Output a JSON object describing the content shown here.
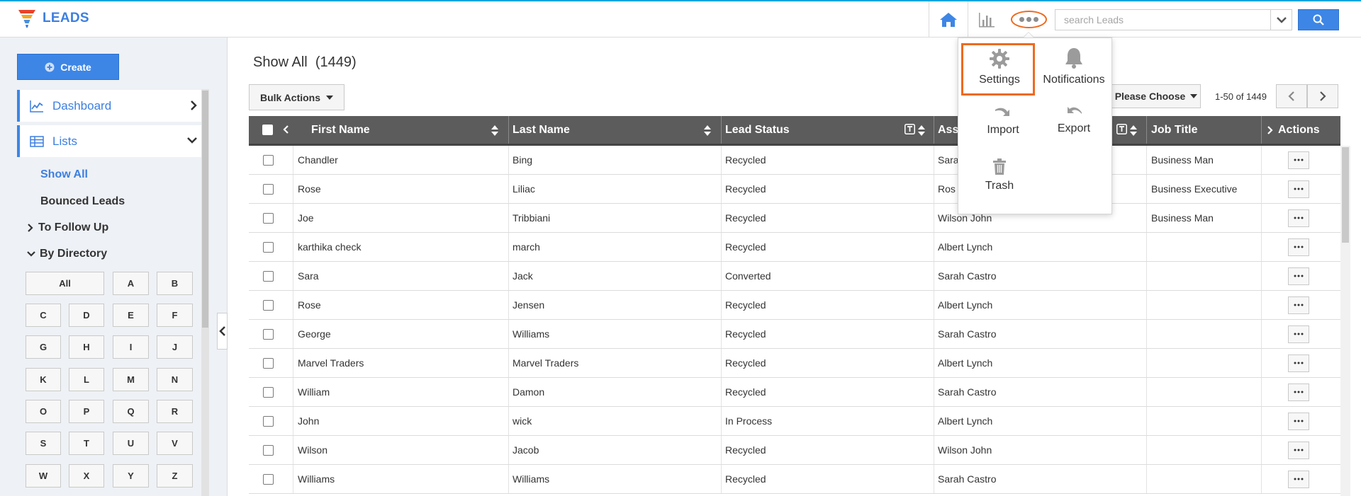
{
  "app": {
    "title": "LEADS",
    "brand_color": "#3d7fe0"
  },
  "header": {
    "search_placeholder": "search Leads",
    "icons": [
      "home-icon",
      "bar-chart-icon",
      "more-icon",
      "chevron-down-icon",
      "search-icon"
    ]
  },
  "more_menu": {
    "items": [
      {
        "label": "Settings",
        "icon": "gear-icon",
        "highlighted": true
      },
      {
        "label": "Notifications",
        "icon": "bell-icon"
      },
      {
        "label": "Import",
        "icon": "import-icon"
      },
      {
        "label": "Export",
        "icon": "export-icon"
      },
      {
        "label": "Trash",
        "icon": "trash-icon"
      }
    ]
  },
  "sidebar": {
    "create_label": "Create",
    "dashboard_label": "Dashboard",
    "lists_label": "Lists",
    "show_all_label": "Show All",
    "bounced_label": "Bounced Leads",
    "follow_up_label": "To Follow Up",
    "by_directory_label": "By Directory",
    "letters": [
      "All",
      "A",
      "B",
      "C",
      "D",
      "E",
      "F",
      "G",
      "H",
      "I",
      "J",
      "K",
      "L",
      "M",
      "N",
      "O",
      "P",
      "Q",
      "R",
      "S",
      "T",
      "U",
      "V",
      "W",
      "X",
      "Y",
      "Z"
    ]
  },
  "main": {
    "title": "Show All",
    "count": "(1449)",
    "bulk_actions_label": "Bulk Actions",
    "please_choose_label": "Please Choose",
    "pagination": "1-50 of 1449"
  },
  "table": {
    "columns": {
      "first_name": "First Name",
      "last_name": "Last Name",
      "lead_status": "Lead Status",
      "assigned_to": "Ass",
      "job_title": "Job Title",
      "actions": "Actions"
    },
    "rows": [
      {
        "first": "Chandler",
        "last": "Bing",
        "status": "Recycled",
        "assigned": "Sara",
        "job": "Business Man"
      },
      {
        "first": "Rose",
        "last": "Liliac",
        "status": "Recycled",
        "assigned": "Ros",
        "job": "Business Executive"
      },
      {
        "first": "Joe",
        "last": "Tribbiani",
        "status": "Recycled",
        "assigned": "Wilson John",
        "job": "Business Man"
      },
      {
        "first": "karthika check",
        "last": "march",
        "status": "Recycled",
        "assigned": "Albert Lynch",
        "job": ""
      },
      {
        "first": "Sara",
        "last": "Jack",
        "status": "Converted",
        "assigned": "Sarah Castro",
        "job": ""
      },
      {
        "first": "Rose",
        "last": "Jensen",
        "status": "Recycled",
        "assigned": "Albert Lynch",
        "job": ""
      },
      {
        "first": "George",
        "last": "Williams",
        "status": "Recycled",
        "assigned": "Sarah Castro",
        "job": ""
      },
      {
        "first": "Marvel Traders",
        "last": "Marvel Traders",
        "status": "Recycled",
        "assigned": "Albert Lynch",
        "job": ""
      },
      {
        "first": "William",
        "last": "Damon",
        "status": "Recycled",
        "assigned": "Sarah Castro",
        "job": ""
      },
      {
        "first": "John",
        "last": "wick",
        "status": "In Process",
        "assigned": "Albert Lynch",
        "job": ""
      },
      {
        "first": "Wilson",
        "last": "Jacob",
        "status": "Recycled",
        "assigned": "Wilson John",
        "job": ""
      },
      {
        "first": "Williams",
        "last": "Williams",
        "status": "Recycled",
        "assigned": "Sarah Castro",
        "job": ""
      }
    ]
  },
  "colors": {
    "accent": "#3d86e6",
    "highlight": "#ee6a1f",
    "header_bg": "#5c5c5c"
  }
}
